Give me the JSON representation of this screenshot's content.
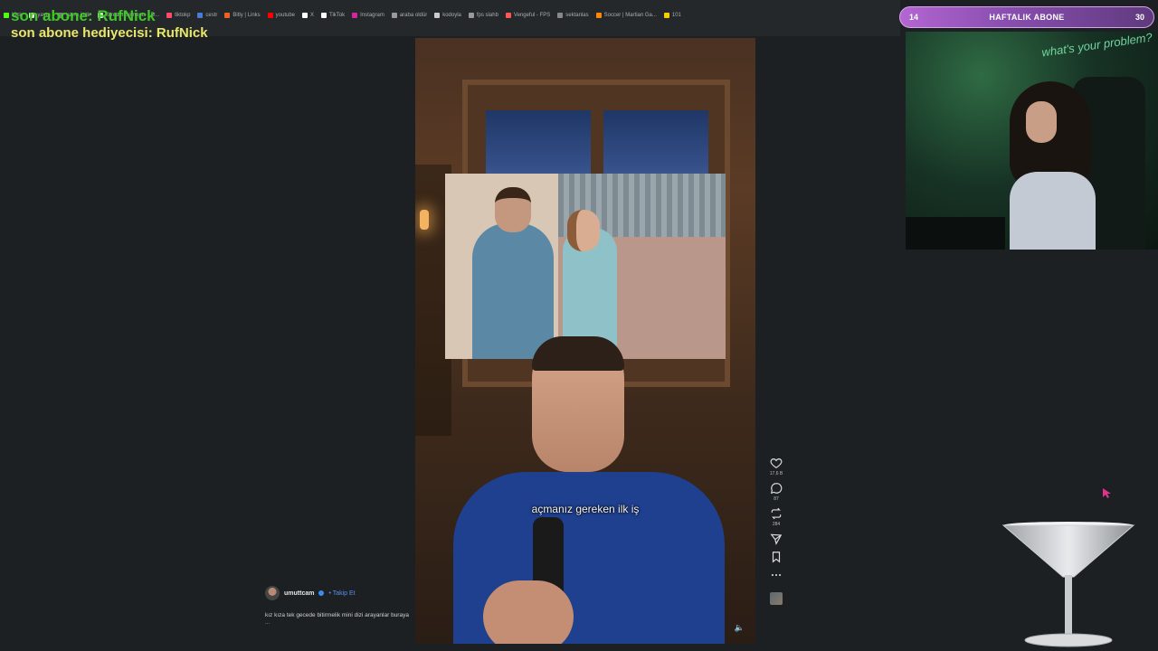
{
  "bookmarks": [
    {
      "label": "Kick",
      "color": "#53fc18"
    },
    {
      "label": "yayın",
      "color": "#e0e0e0"
    },
    {
      "label": "yayın indir",
      "color": "#7a7a7a"
    },
    {
      "label": "StreamElements - D...",
      "color": "#e0e0e0"
    },
    {
      "label": "tiktokp",
      "color": "#ff4a6a"
    },
    {
      "label": "cestr",
      "color": "#4b7bd8"
    },
    {
      "label": "Bitly | Links",
      "color": "#ee6123"
    },
    {
      "label": "youtube",
      "color": "#ff0000"
    },
    {
      "label": "X",
      "color": "#ffffff"
    },
    {
      "label": "TikTok",
      "color": "#ffffff"
    },
    {
      "label": "Instagram",
      "color": "#d6249f"
    },
    {
      "label": "araba oldür",
      "color": "#999999"
    },
    {
      "label": "kodoyla",
      "color": "#cccccc"
    },
    {
      "label": "fps slahb",
      "color": "#999999"
    },
    {
      "label": "Vengeful - FPS",
      "color": "#ff5555"
    },
    {
      "label": "sektanlas",
      "color": "#888888"
    },
    {
      "label": "Soccer | Martian Ga...",
      "color": "#ff8800"
    },
    {
      "label": "101",
      "color": "#f0d000"
    }
  ],
  "overlay": {
    "last_sub": "son abone: RufNick",
    "last_gift": "son abone hediyecisi: RufNick"
  },
  "weekly": {
    "current": "14",
    "label": "HAFTALIK ABONE",
    "goal": "30",
    "progress": 0.47
  },
  "webcam": {
    "neon_text": "what's your problem?"
  },
  "video": {
    "caption": "açmanız gereken ilk iş"
  },
  "actions": {
    "likes": "17,6 B",
    "comments": "87",
    "reposts": "284"
  },
  "author": {
    "username": "umuttcam",
    "follow_label": "• Takip Et",
    "description": "kız kıza tek gecede bitirmelik mini dizi arayanlar buraya",
    "more": "..."
  },
  "colors": {
    "background": "#1c2023",
    "sub_green": "#3ec925",
    "sub_yellow": "#e9e76a",
    "weekly_purple": "#b366d1",
    "follow_blue": "#5d8ee8",
    "cursor_pink": "#e0338f"
  }
}
